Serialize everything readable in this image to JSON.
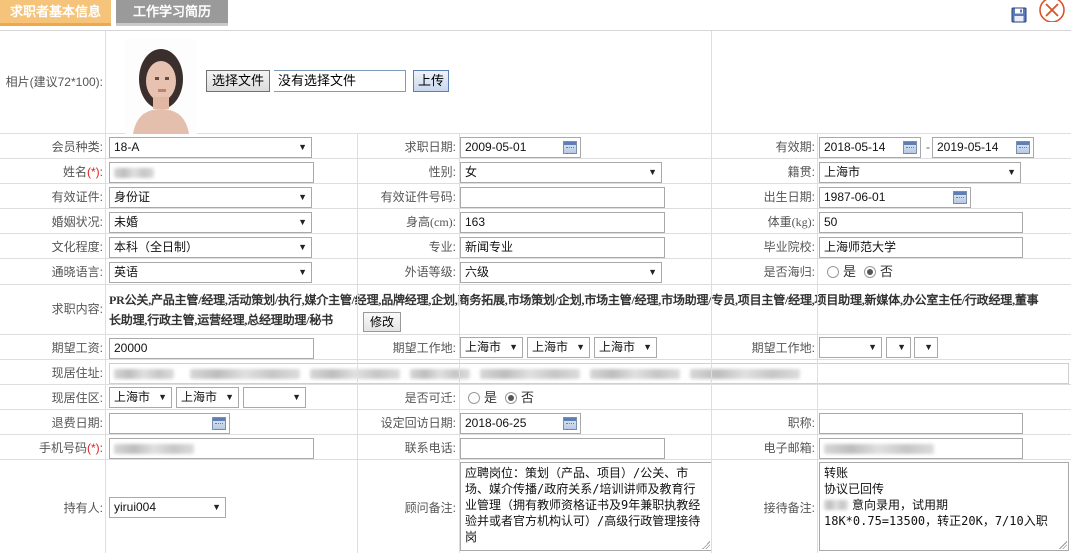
{
  "tabs": [
    {
      "label": "求职者基本信息",
      "active": true
    },
    {
      "label": "工作学习简历",
      "active": false
    }
  ],
  "icons": {
    "save": "save-icon",
    "close": "close-icon"
  },
  "photo": {
    "label": "相片(建议72*100):",
    "choose_file": "选择文件",
    "no_file": "没有选择文件",
    "upload": "上传"
  },
  "member_type": {
    "label": "会员种类:",
    "value": "18-A"
  },
  "job_date": {
    "label": "求职日期:",
    "value": "2009-05-01"
  },
  "validity": {
    "label": "有效期:",
    "from": "2018-05-14",
    "sep": "-",
    "to": "2019-05-14"
  },
  "name": {
    "label": "姓名",
    "required": "(*)",
    "colon": ":"
  },
  "gender": {
    "label": "性别:",
    "value": "女"
  },
  "native_place": {
    "label": "籍贯:",
    "value": "上海市"
  },
  "id_type": {
    "label": "有效证件:",
    "value": "身份证"
  },
  "id_number": {
    "label": "有效证件号码:",
    "value": ""
  },
  "birth_date": {
    "label": "出生日期:",
    "value": "1987-06-01"
  },
  "marital": {
    "label": "婚姻状况:",
    "value": "未婚"
  },
  "height": {
    "label": "身高",
    "unit": "(cm)",
    "colon": ":",
    "value": "163"
  },
  "weight": {
    "label": "体重",
    "unit": "(kg)",
    "colon": ":",
    "value": "50"
  },
  "education": {
    "label": "文化程度:",
    "value": "本科（全日制）"
  },
  "major": {
    "label": "专业:",
    "value": "新闻专业"
  },
  "school": {
    "label": "毕业院校:",
    "value": "上海师范大学"
  },
  "language": {
    "label": "通晓语言:",
    "value": "英语"
  },
  "language_level": {
    "label": "外语等级:",
    "value": "六级"
  },
  "overseas": {
    "label": "是否海归:",
    "yes": "是",
    "no": "否",
    "selected": "no"
  },
  "job_content": {
    "label": "求职内容:",
    "line1": "PR公关,产品主管/经理,活动策划/执行,媒介主管/经理,品牌经理,企划,商务拓展,市场策划/企划,市场主管/经理,市场助理/专员,项目主管/经理,项目助理,新媒体,办公室主任/行政经理,董事",
    "line2": "长助理,行政主管,运营经理,总经理助理/秘书",
    "edit": "修改"
  },
  "expected_salary": {
    "label": "期望工资:",
    "value": "20000"
  },
  "expected_location": {
    "label": "期望工作地:",
    "v1": "上海市",
    "v2": "上海市",
    "v3": "上海市"
  },
  "expected_location2": {
    "label": "期望工作地:",
    "v1": "",
    "v2": "",
    "v3": ""
  },
  "current_address": {
    "label": "现居住址:"
  },
  "current_district": {
    "label": "现居住区:",
    "v1": "上海市",
    "v2": "上海市",
    "v3": ""
  },
  "relocate": {
    "label": "是否可迁:",
    "yes": "是",
    "no": "否",
    "selected": "no"
  },
  "refund_date": {
    "label": "退费日期:",
    "value": ""
  },
  "revisit_date": {
    "label": "设定回访日期:",
    "value": "2018-06-25"
  },
  "title": {
    "label": "职称:",
    "value": ""
  },
  "mobile": {
    "label": "手机号码",
    "required": "(*)",
    "colon": ":"
  },
  "phone": {
    "label": "联系电话:",
    "value": ""
  },
  "email": {
    "label": "电子邮箱:"
  },
  "holder": {
    "label": "持有人:",
    "value": "yirui004"
  },
  "consultant_note": {
    "label": "顾问备注:",
    "value": "应聘岗位：策划（产品、项目）/公关、市场、媒介传播/政府关系/培训讲师及教育行业管理（拥有教师资格证书及9年兼职执教经验并或者官方机构认可）/高级行政管理接待岗"
  },
  "reception_note": {
    "label": "接待备注:",
    "line1": "转账",
    "line2": "协议已回传",
    "line3": "意向录用，试用期",
    "line4": "18K*0.75=13500，转正20K，7/10入职"
  },
  "colors": {
    "tab_active": "#f5c37a",
    "tab_inactive": "#9a9a9a",
    "required": "#e02020",
    "close": "#d9532b"
  }
}
